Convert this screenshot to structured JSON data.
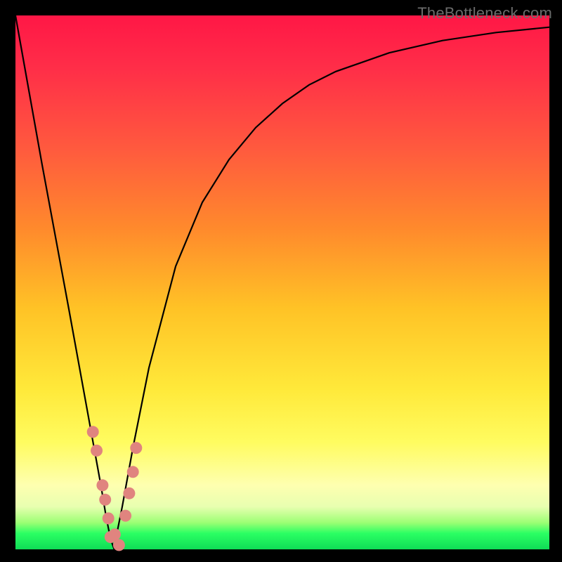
{
  "watermark": "TheBottleneck.com",
  "chart_data": {
    "type": "line",
    "title": "",
    "xlabel": "",
    "ylabel": "",
    "xlim": [
      0,
      100
    ],
    "ylim": [
      0,
      100
    ],
    "series": [
      {
        "name": "bottleneck-curve",
        "x": [
          0,
          5,
          10,
          12,
          14,
          16,
          17,
          17.8,
          18.5,
          19,
          20,
          22,
          25,
          30,
          35,
          40,
          45,
          50,
          55,
          60,
          70,
          80,
          90,
          100
        ],
        "values": [
          100,
          72,
          45,
          34,
          23,
          12,
          6,
          2,
          0,
          3,
          8,
          19,
          34,
          53,
          65,
          73,
          79,
          83.5,
          87,
          89.5,
          93,
          95.3,
          96.8,
          97.8
        ]
      }
    ],
    "markers": {
      "name": "highlight-points",
      "x": [
        14.5,
        15.2,
        16.3,
        16.8,
        17.4,
        17.8,
        18.6,
        19.4,
        20.6,
        21.3,
        22,
        22.6
      ],
      "values": [
        22,
        18.5,
        12,
        9.3,
        5.8,
        2.3,
        2.8,
        0.8,
        6.3,
        10.5,
        14.5,
        19
      ]
    },
    "background": {
      "type": "vertical-gradient",
      "stops": [
        {
          "pos": 0,
          "color": "#ff1746"
        },
        {
          "pos": 55,
          "color": "#ffc326"
        },
        {
          "pos": 80,
          "color": "#fffc60"
        },
        {
          "pos": 97,
          "color": "#2bff63"
        },
        {
          "pos": 100,
          "color": "#0fdc56"
        }
      ]
    }
  }
}
